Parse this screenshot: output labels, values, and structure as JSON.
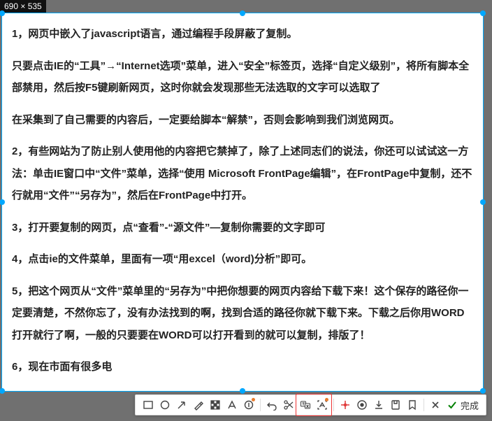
{
  "dim_badge": "690 × 535",
  "paragraphs": [
    "1，网页中嵌入了javascript语言，通过编程手段屏蔽了复制。",
    "只要点击IE的“工具”→“Internet选项”菜单，进入“安全”标签页，选择“自定义级别”，将所有脚本全部禁用，然后按F5键刷新网页，这时你就会发现那些无法选取的文字可以选取了",
    "在采集到了自己需要的内容后，一定要给脚本“解禁”，否则会影响到我们浏览网页。",
    "2，有些网站为了防止别人使用他的内容把它禁掉了，除了上述同志们的说法，你还可以试试这一方法：单击IE窗口中“文件”菜单，选择“使用 Microsoft FrontPage编辑”，在FrontPage中复制，还不行就用“文件”“另存为”，然后在FrontPage中打开。",
    "3，打开要复制的网页，点“查看”-“源文件”—复制你需要的文字即可",
    "4，点击ie的文件菜单，里面有一项“用excel（word)分析”即可。",
    "5，把这个网页从“文件”菜单里的“另存为”中把你想要的网页内容给下载下来！这个保存的路径你一定要清楚，不然你忘了，没有办法找到的啊，找到合适的路径你就下载下来。下载之后你用WORD打开就行了啊，一般的只要要在WORD可以打开看到的就可以复制，排版了！",
    "6，现在市面有很多电"
  ],
  "toolbar": {
    "done_label": "完成"
  }
}
